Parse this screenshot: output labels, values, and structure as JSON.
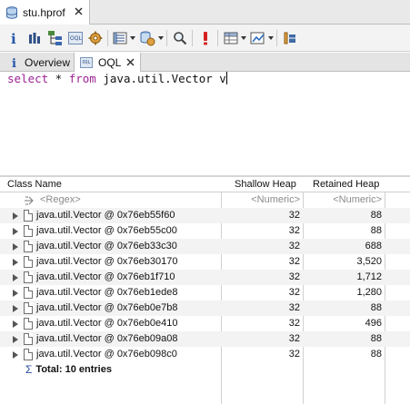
{
  "editor_tab": {
    "title": "stu.hprof",
    "icon": "database-icon"
  },
  "toolbar": {
    "buttons": [
      "info-icon",
      "bar-chart-icon",
      "class-hierarchy-icon",
      "oql-icon",
      "settings-icon",
      "list-dropdown-icon",
      "stack-dropdown-icon",
      "search-icon",
      "alert-icon",
      "table-dropdown-icon",
      "chart-dropdown-icon",
      "bookmark-icon"
    ]
  },
  "sub_tabs": [
    {
      "label": "Overview",
      "icon": "info-icon"
    },
    {
      "label": "OQL",
      "icon": "oql-icon"
    }
  ],
  "query": {
    "keyword_select": "select",
    "star": " * ",
    "keyword_from": "from",
    "rest": " java.util.Vector v"
  },
  "table": {
    "headers": {
      "class_name": "Class Name",
      "shallow": "Shallow Heap",
      "retained": "Retained Heap"
    },
    "filter": {
      "name": "<Regex>",
      "shallow": "<Numeric>",
      "retained": "<Numeric>"
    },
    "rows": [
      {
        "name": "java.util.Vector @ 0x76eb55f60",
        "shallow": "32",
        "retained": "88"
      },
      {
        "name": "java.util.Vector @ 0x76eb55c00",
        "shallow": "32",
        "retained": "88"
      },
      {
        "name": "java.util.Vector @ 0x76eb33c30",
        "shallow": "32",
        "retained": "688"
      },
      {
        "name": "java.util.Vector @ 0x76eb30170",
        "shallow": "32",
        "retained": "3,520"
      },
      {
        "name": "java.util.Vector @ 0x76eb1f710",
        "shallow": "32",
        "retained": "1,712"
      },
      {
        "name": "java.util.Vector @ 0x76eb1ede8",
        "shallow": "32",
        "retained": "1,280"
      },
      {
        "name": "java.util.Vector @ 0x76eb0e7b8",
        "shallow": "32",
        "retained": "88"
      },
      {
        "name": "java.util.Vector @ 0x76eb0e410",
        "shallow": "32",
        "retained": "496"
      },
      {
        "name": "java.util.Vector @ 0x76eb09a08",
        "shallow": "32",
        "retained": "88"
      },
      {
        "name": "java.util.Vector @ 0x76eb098c0",
        "shallow": "32",
        "retained": "88"
      }
    ],
    "total": "Total: 10 entries"
  },
  "colors": {
    "keyword": "#9b2393",
    "hint": "#8a8a8a",
    "alt_row": "#f3f3f3"
  }
}
